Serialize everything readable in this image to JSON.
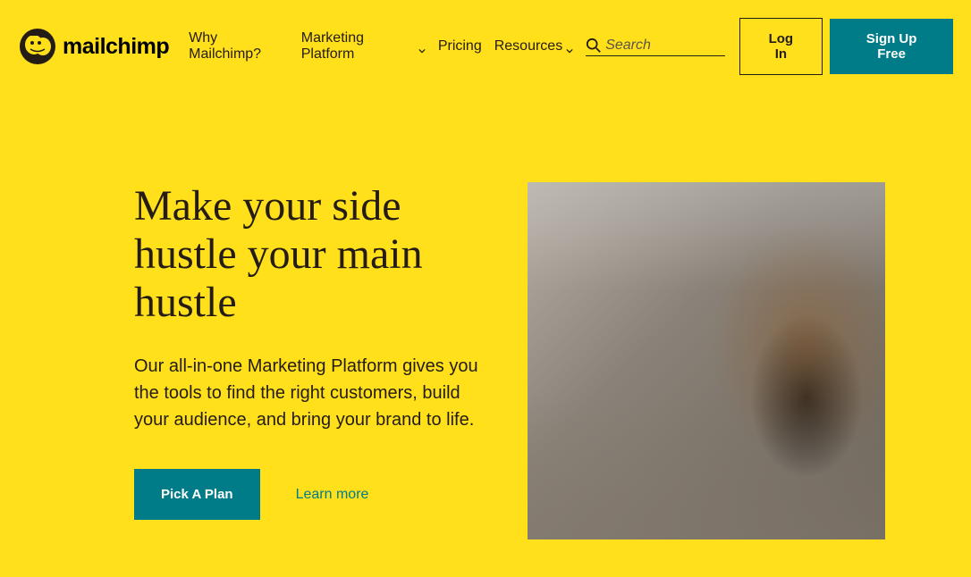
{
  "brand": {
    "name": "mailchimp"
  },
  "nav": {
    "items": [
      {
        "label": "Why Mailchimp?",
        "hasDropdown": false
      },
      {
        "label": "Marketing Platform",
        "hasDropdown": true
      },
      {
        "label": "Pricing",
        "hasDropdown": false
      },
      {
        "label": "Resources",
        "hasDropdown": true
      }
    ]
  },
  "search": {
    "placeholder": "Search"
  },
  "auth": {
    "login": "Log In",
    "signup": "Sign Up Free"
  },
  "hero": {
    "title": "Make your side hustle your main hustle",
    "subtitle": "Our all-in-one Marketing Platform gives you the tools to find the right customers, build your audience, and bring your brand to life.",
    "cta": "Pick A Plan",
    "secondary": "Learn more",
    "image_alt": "Smiling woman sitting in a chair"
  },
  "colors": {
    "background": "#ffe01b",
    "accent": "#007c89",
    "text": "#241c15"
  }
}
